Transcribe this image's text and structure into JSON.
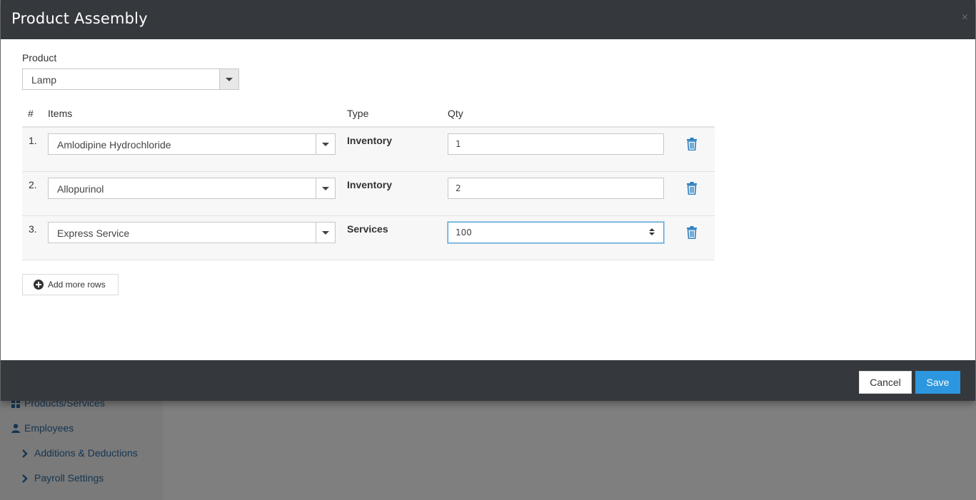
{
  "background": {
    "nav": [
      {
        "label": "Products/Services",
        "icon": "grid-icon"
      },
      {
        "label": "Employees",
        "icon": "user-icon"
      },
      {
        "label": "Additions & Deductions",
        "icon": "chevron-right-icon"
      },
      {
        "label": "Payroll Settings",
        "icon": "chevron-right-icon"
      }
    ]
  },
  "modal": {
    "title": "Product Assembly",
    "close_symbol": "×",
    "product_label": "Product",
    "product_value": "Lamp",
    "table": {
      "headers": {
        "num": "#",
        "items": "Items",
        "type": "Type",
        "qty": "Qty"
      },
      "rows": [
        {
          "num": "1.",
          "item": "Amlodipine Hydrochloride",
          "type": "Inventory",
          "qty": "1"
        },
        {
          "num": "2.",
          "item": "Allopurinol",
          "type": "Inventory",
          "qty": "2"
        },
        {
          "num": "3.",
          "item": "Express Service",
          "type": "Services",
          "qty": "100"
        }
      ]
    },
    "add_rows_label": "Add more rows",
    "cancel_label": "Cancel",
    "save_label": "Save"
  },
  "colors": {
    "header_bg": "#35383d",
    "accent": "#2c97de",
    "trash_icon": "#2c7fc1"
  }
}
